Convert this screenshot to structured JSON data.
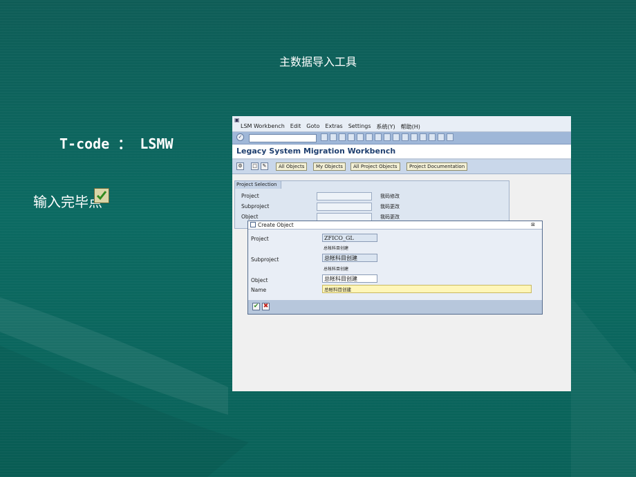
{
  "slide": {
    "title": "主数据导入工具",
    "tcode": "T-code ： LSMW",
    "instruction": "输入完毕点"
  },
  "sap": {
    "menu": [
      "LSM Workbench",
      "Edit",
      "Goto",
      "Extras",
      "Settings",
      "系统(Y)",
      "帮助(H)"
    ],
    "title": "Legacy System Migration Workbench",
    "buttons": [
      "All Objects",
      "My Objects",
      "All Project Objects",
      "Project Documentation"
    ],
    "selection": {
      "tab": "Project Selection",
      "rows": [
        {
          "label": "Project",
          "desc": "我码修改"
        },
        {
          "label": "Subproject",
          "desc": "我码更改"
        },
        {
          "label": "Object",
          "desc": "我码更改"
        }
      ]
    },
    "dialog": {
      "title": "Create Object",
      "project_label": "Project",
      "project_value": "ZFICO_GL",
      "project_desc": "总帐科目创建",
      "subproject_label": "Subproject",
      "subproject_value": "总帐科目创建",
      "subproject_desc": "总帐科目创建",
      "object_label": "Object",
      "object_value": "总帐科目创建",
      "name_label": "Name",
      "name_value": "总帐科目创建"
    }
  },
  "colors": {
    "background": "#0c6a62",
    "sap_toolbar": "#9fb7d8",
    "sap_title_text": "#1f3f6f"
  }
}
